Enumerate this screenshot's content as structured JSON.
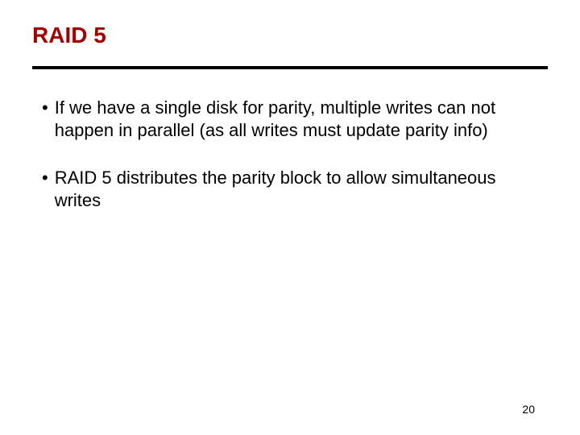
{
  "title": "RAID 5",
  "bullets": [
    "If we have a single disk for parity, multiple writes can not happen in parallel (as all writes must update parity info)",
    "RAID 5 distributes the parity block to allow simultaneous writes"
  ],
  "page_number": "20"
}
